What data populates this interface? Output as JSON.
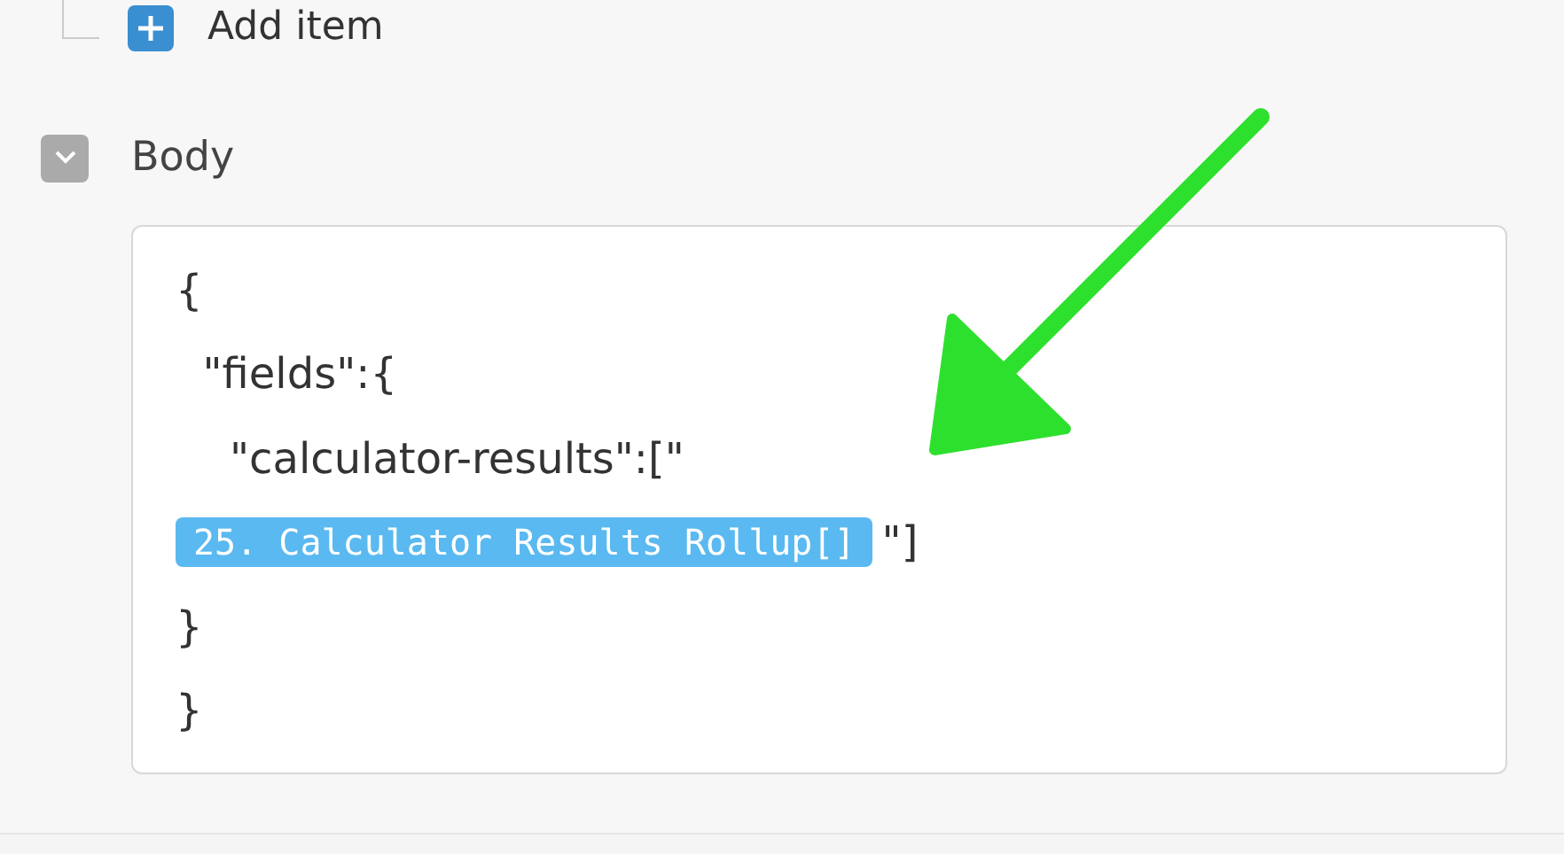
{
  "add_item": {
    "label": "Add item"
  },
  "section": {
    "title": "Body",
    "expanded": true,
    "lines": [
      {
        "kind": "text",
        "text": "{"
      },
      {
        "kind": "text",
        "text": "  \"fields\":{"
      },
      {
        "kind": "text",
        "text": "    \"calculator-results\":[\""
      },
      {
        "kind": "token",
        "token": "25. Calculator Results Rollup[]",
        "text": "\"]"
      },
      {
        "kind": "text",
        "text": "}"
      },
      {
        "kind": "text",
        "text": "}"
      }
    ]
  }
}
